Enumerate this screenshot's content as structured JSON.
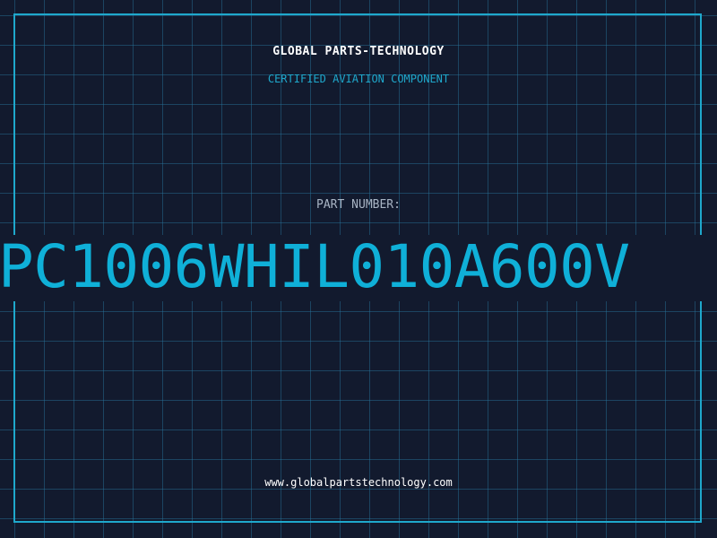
{
  "header": {
    "company": "GLOBAL PARTS-TECHNOLOGY",
    "subtitle": "CERTIFIED AVIATION COMPONENT"
  },
  "part": {
    "label": "PART NUMBER:",
    "number": "PC1006WHIL010A600V"
  },
  "footer": {
    "url": "www.globalpartstechnology.com"
  },
  "colors": {
    "background": "#121a2e",
    "accent": "#1fa8cc",
    "part_number": "#0fb0d8",
    "grid": "#28789f"
  }
}
